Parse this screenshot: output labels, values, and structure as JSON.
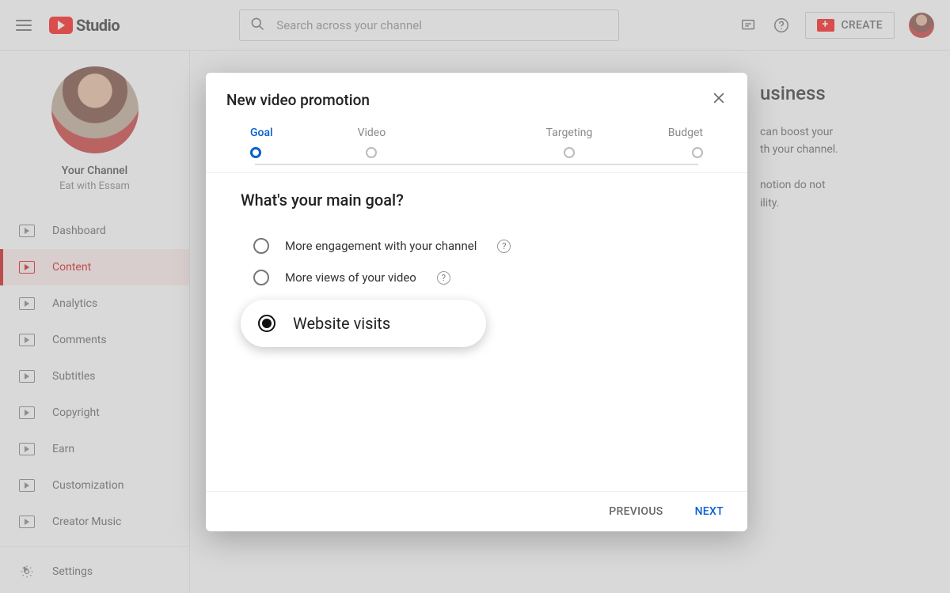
{
  "header": {
    "logo_text": "Studio",
    "search_placeholder": "Search across your channel",
    "create_label": "CREATE"
  },
  "sidebar": {
    "channel_name": "Your Channel",
    "channel_subtitle": "Eat with Essam",
    "items": [
      {
        "label": "Dashboard"
      },
      {
        "label": "Content"
      },
      {
        "label": "Analytics"
      },
      {
        "label": "Comments"
      },
      {
        "label": "Subtitles"
      },
      {
        "label": "Copyright"
      },
      {
        "label": "Earn"
      },
      {
        "label": "Customization"
      },
      {
        "label": "Creator Music"
      }
    ],
    "settings_label": "Settings",
    "active_index": 1
  },
  "main": {
    "title_fragment": "usiness",
    "para1_fragment": "can boost your",
    "para2_fragment": "th your channel.",
    "para3_fragment": "notion do not",
    "para4_fragment": "ility."
  },
  "modal": {
    "title": "New video promotion",
    "steps": [
      {
        "label": "Goal",
        "active": true
      },
      {
        "label": "Video",
        "active": false
      },
      {
        "label": "Targeting",
        "active": false
      },
      {
        "label": "Budget",
        "active": false
      }
    ],
    "question": "What's your main goal?",
    "goals": [
      {
        "label": "More engagement with your channel",
        "help": true
      },
      {
        "label": "More views of your video",
        "help": true
      }
    ],
    "selected_goal": "Website visits",
    "prev_label": "PREVIOUS",
    "next_label": "NEXT"
  },
  "colors": {
    "accent_blue": "#065fd4",
    "brand_red": "#ff0000"
  }
}
